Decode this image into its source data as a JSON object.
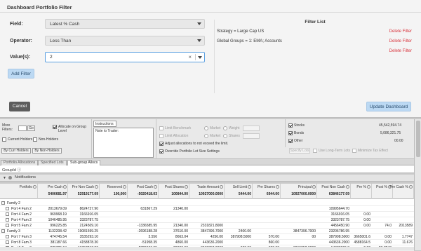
{
  "dialog": {
    "title": "Dashboard Portfolio Filter",
    "field_label": "Field:",
    "field_value": "Latest % Cash",
    "operator_label": "Operator:",
    "operator_value": "Less Than",
    "value_label": "Value(s):",
    "value_input": "2",
    "add_filter": "Add Filter",
    "cancel": "Cancel",
    "update": "Update Dashboard",
    "filter_list": {
      "title": "Filter List",
      "items": [
        {
          "text": "Strategy = Large Cap US",
          "delete": "Delete Filter"
        },
        {
          "text": "Global Groups = 1: EMA; Accounts",
          "delete": "Delete Filter"
        },
        {
          "text": "",
          "delete": "Delete Filter"
        }
      ]
    }
  },
  "controls": {
    "more_filters": "More Filters:",
    "go": "Go",
    "current_holders": "Current Holders",
    "non_holders": "Non-Holders",
    "by_curr_holders": "By Curr Holders",
    "by_non_holders": "By Non-Holders",
    "allocate_on_group": "Allocate on Group Level",
    "instructions": "Instructions",
    "note_to_trader": "Note to Trader:",
    "limit_benchmark": "Limit Benchmark",
    "limit_allocation": "Limit Allocation",
    "adjust_allocations": "Adjust allocations to not exceed the limit.",
    "override_lot": "Override Portfolio Lot Size Settings",
    "market": "Market",
    "weight": "Weight",
    "shares": "Shares",
    "stocks": "Stocks",
    "bonds": "Bonds",
    "other": "Other",
    "stocks_value": "45,542,594.74",
    "bonds_value": "5,086,321.75",
    "other_value": "00.00",
    "specify_lots": "Specify Lots",
    "use_long_term": "Use Long-Term Lots",
    "minimize_tax": "Minimize Tax Effect"
  },
  "tabs": [
    "Portfolio Allocations",
    "Specified Lots",
    "Sub-group Allocs"
  ],
  "group_bar": "GroupId ⓘ",
  "notifications": "Notifications",
  "grid": {
    "columns": [
      "Portfolio",
      "Pre Cash",
      "Pre Non Cash",
      "Reserved",
      "Post Cash",
      "Post Shares",
      "Trade Amount",
      "Sell Limit",
      "Pre Shares",
      "Principal",
      "Post Non Cash",
      "Pre %",
      "Post %",
      "Pre Cash %"
    ],
    "totals": [
      "",
      "5406681.97",
      "52919177.09",
      "100,000",
      "-5020418.03",
      "100844.00",
      "10927000.0000",
      "5444.00",
      "6944.00",
      "10927000.0000",
      "63846177.09",
      "",
      "",
      ""
    ],
    "rows": [
      {
        "name": "Family 2",
        "type": "group",
        "values": [
          "",
          "",
          "",
          "",
          "",
          "",
          "",
          "",
          "",
          "",
          "",
          "",
          ""
        ]
      },
      {
        "name": "Port 4 Fam 2",
        "type": "child",
        "values": [
          "2013679.09",
          "8624727.90",
          "",
          "631867.29",
          "21340.00",
          "",
          "",
          "",
          "",
          "10995644.70",
          "",
          "",
          ""
        ]
      },
      {
        "name": "Port 4 Fam 2",
        "type": "child",
        "values": [
          "969968.19",
          "3166916.05",
          "",
          "",
          "",
          "",
          "",
          "",
          "",
          "3166916.05",
          "0.00",
          "",
          ""
        ]
      },
      {
        "name": "Port 4 Fam 2",
        "type": "child",
        "values": [
          "1046485.95",
          "3323787.75",
          "",
          "",
          "",
          "",
          "",
          "",
          "",
          "3323787.75",
          "0.00",
          "",
          ""
        ]
      },
      {
        "name": "Port 5 Fam 2",
        "type": "child",
        "values": [
          "996225.85",
          "2124509.10",
          "",
          "-1336585.95",
          "21340.00",
          "2331821.8000",
          "",
          "",
          "",
          "4456450.90",
          "0.00",
          "74.0",
          "2013589"
        ]
      },
      {
        "name": "Family 3",
        "type": "group",
        "values": [
          "1132208.42",
          "19081599.25",
          "",
          "-2696188.28",
          "37610.00",
          "3847396.7000",
          "2400.00",
          "",
          "3847396.7000",
          "23206786.95",
          "",
          "",
          ""
        ]
      },
      {
        "name": "Port 7 Fam 3",
        "type": "child",
        "values": [
          "474745.54",
          "3535293.10",
          "",
          "3.556",
          "8663.04",
          "4256.00",
          "387908.5000",
          "570.00",
          "00",
          "387908.5000",
          "3665001.6",
          "0.00",
          "1.7747"
        ]
      },
      {
        "name": "Port 8 Fam 3",
        "type": "child",
        "values": [
          "381187.66",
          "4158878.30",
          "",
          "-51958.35",
          "4860.00",
          "443636.2000",
          "",
          "860.00",
          "",
          "443636.2000",
          "4588164.5",
          "0.00",
          "11.676"
        ]
      },
      {
        "name": "Port 9 Fam 3",
        "type": "child",
        "values": [
          "276785.04",
          "11357217.80",
          "",
          "-2720666.95",
          "20000.00",
          "3015852.0000",
          "900.00",
          "300.00",
          "3015852.0000",
          "14373069.8",
          "0.00",
          "26.7243",
          ""
        ]
      }
    ]
  }
}
